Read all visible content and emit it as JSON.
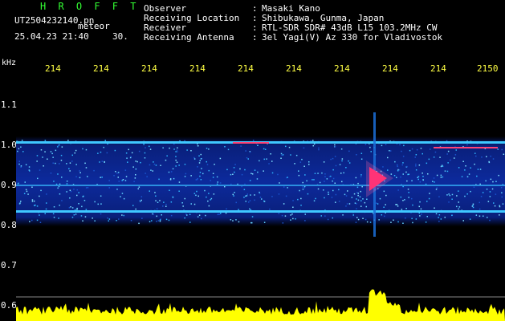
{
  "header": {
    "app_title": "H R O F F T",
    "file_name": "UT2504232140.pn",
    "meteor_label": "meteor",
    "date_time": "25.04.23 21:40",
    "timescale": "30."
  },
  "meta": [
    {
      "label": "Observer",
      "sep": ":",
      "value": "Masaki Kano"
    },
    {
      "label": "Receiving Location",
      "sep": ":",
      "value": "Shibukawa, Gunma, Japan"
    },
    {
      "label": "Receiver",
      "sep": ":",
      "value": "RTL-SDR SDR# 43dB L15 103.2MHz CW"
    },
    {
      "label": "Receiving Antenna",
      "sep": ":",
      "value": "3el Yagi(V) Az 330 for Vladivostok"
    }
  ],
  "axes": {
    "y_unit": "kHz",
    "x_ticks": [
      "214",
      "214",
      "214",
      "214",
      "214",
      "214",
      "214",
      "214",
      "214",
      "2150"
    ],
    "y_ticks": [
      "1.1",
      "1.0",
      "0.9",
      "0.8",
      "0.7",
      "0.6"
    ]
  },
  "colors": {
    "background": "#000000",
    "title": "#33ff33",
    "tick_yellow": "#ffff44",
    "text": "#ffffff",
    "signal_blue": "#0a2a9a",
    "signal_cyan": "#2fb6ff",
    "echo_red": "#ff2266",
    "power_yellow": "#ffff00"
  }
}
